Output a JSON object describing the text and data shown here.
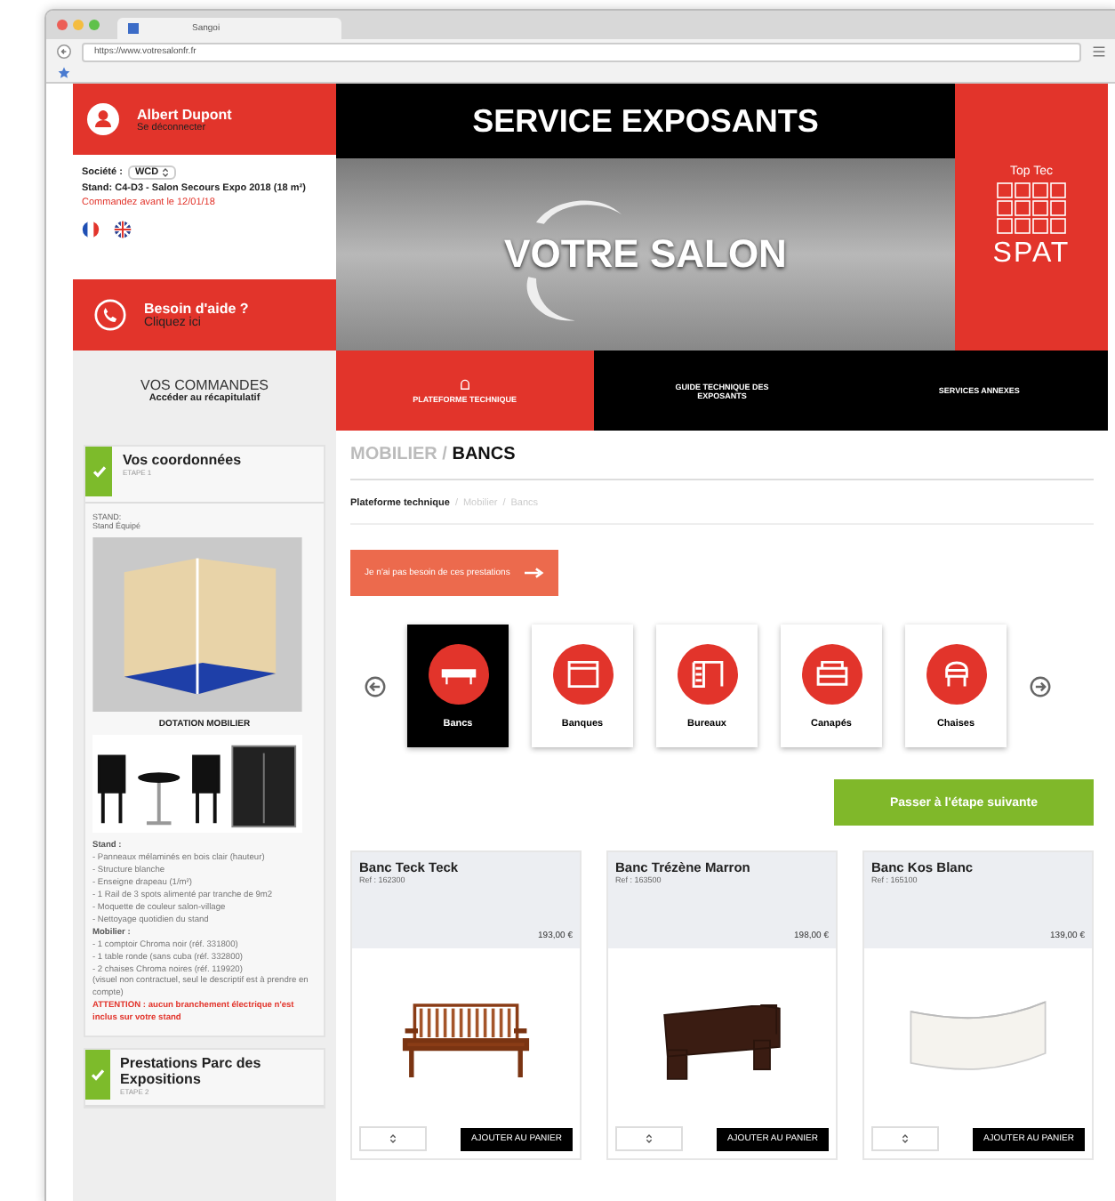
{
  "browser": {
    "tab_title": "Sangoi",
    "url": "https://www.votresalonfr.fr"
  },
  "user": {
    "name": "Albert Dupont",
    "logout": "Se déconnecter"
  },
  "company": {
    "label": "Société :",
    "value": "WCD",
    "stand": "Stand: C4-D3 - Salon Secours Expo 2018 (18 m²)",
    "deadline": "Commandez avant le 12/01/18"
  },
  "languages": [
    {
      "kind": "french"
    },
    {
      "kind": "english"
    }
  ],
  "help": {
    "title": "Besoin d'aide ?",
    "link": "Cliquez ici"
  },
  "orders": {
    "title": "VOS COMMANDES",
    "subtitle": "Accéder au récapitulatif"
  },
  "steps": [
    {
      "title": "Vos coordonnées",
      "step": "ETAPE 1",
      "completed": true
    },
    {
      "title": "Prestations Parc des Expositions",
      "step": "ETAPE 2",
      "completed": true
    }
  ],
  "stand_panel": {
    "label": "STAND:",
    "type": "Stand Équipé",
    "furniture_heading": "DOTATION MOBILIER",
    "lines": [
      {
        "kind": "heading",
        "text": "Stand :"
      },
      {
        "kind": "item",
        "text": "- Panneaux mélaminés en bois clair (hauteur)"
      },
      {
        "kind": "item",
        "text": "- Structure blanche"
      },
      {
        "kind": "item",
        "text": "- Enseigne drapeau (1/m²)"
      },
      {
        "kind": "item",
        "text": "- 1 Rail de 3 spots alimenté par tranche de 9m2"
      },
      {
        "kind": "item",
        "text": "- Moquette de couleur salon-village"
      },
      {
        "kind": "item",
        "text": "- Nettoyage quotidien du stand"
      },
      {
        "kind": "heading",
        "text": "Mobilier :"
      },
      {
        "kind": "item",
        "text": "- 1 comptoir Chroma noir (réf. 331800)"
      },
      {
        "kind": "item",
        "text": "- 1 table ronde (sans cuba (réf. 332800)"
      },
      {
        "kind": "item",
        "text": "- 2 chaises Chroma noires (réf. 119920)"
      },
      {
        "kind": "item",
        "text": "(visuel non contractuel, seul le descriptif est à prendre en compte)"
      },
      {
        "kind": "warning",
        "text": "ATTENTION : aucun branchement électrique n'est inclus sur votre stand"
      }
    ]
  },
  "banner": {
    "title": "SERVICE EXPOSANTS",
    "salon": "VOTRE SALON",
    "brand_top": "Top Tec",
    "brand": "SPAT"
  },
  "nav": [
    {
      "label": "PLATEFORME TECHNIQUE",
      "selected": true
    },
    {
      "label": "GUIDE TECHNIQUE DES EXPOSANTS",
      "selected": false
    },
    {
      "label": "SERVICES ANNEXES",
      "selected": false
    }
  ],
  "heading": {
    "parent": "MOBILIER /",
    "current": "BANCS"
  },
  "breadcrumb": {
    "separator": "/",
    "items": [
      "Plateforme technique",
      "Mobilier",
      "Bancs"
    ]
  },
  "skip_button": "Je n'ai pas besoin de ces prestations",
  "categories": [
    {
      "label": "Bancs",
      "kind": "bench",
      "selected": true
    },
    {
      "label": "Banques",
      "kind": "counter",
      "selected": false
    },
    {
      "label": "Bureaux",
      "kind": "desk",
      "selected": false
    },
    {
      "label": "Canapés",
      "kind": "sofa",
      "selected": false
    },
    {
      "label": "Chaises",
      "kind": "chair",
      "selected": false
    }
  ],
  "next_button": "Passer à l'étape suivante",
  "products": [
    {
      "name": "Banc Teck Teck",
      "ref": "Ref : 162300",
      "price": "193,00 €",
      "kind": "wood",
      "button": "AJOUTER AU PANIER"
    },
    {
      "name": "Banc Trézène Marron",
      "ref": "Ref : 163500",
      "price": "198,00 €",
      "kind": "dark",
      "button": "AJOUTER AU PANIER"
    },
    {
      "name": "Banc Kos Blanc",
      "ref": "Ref : 165100",
      "price": "139,00 €",
      "kind": "white",
      "button": "AJOUTER AU PANIER"
    }
  ]
}
